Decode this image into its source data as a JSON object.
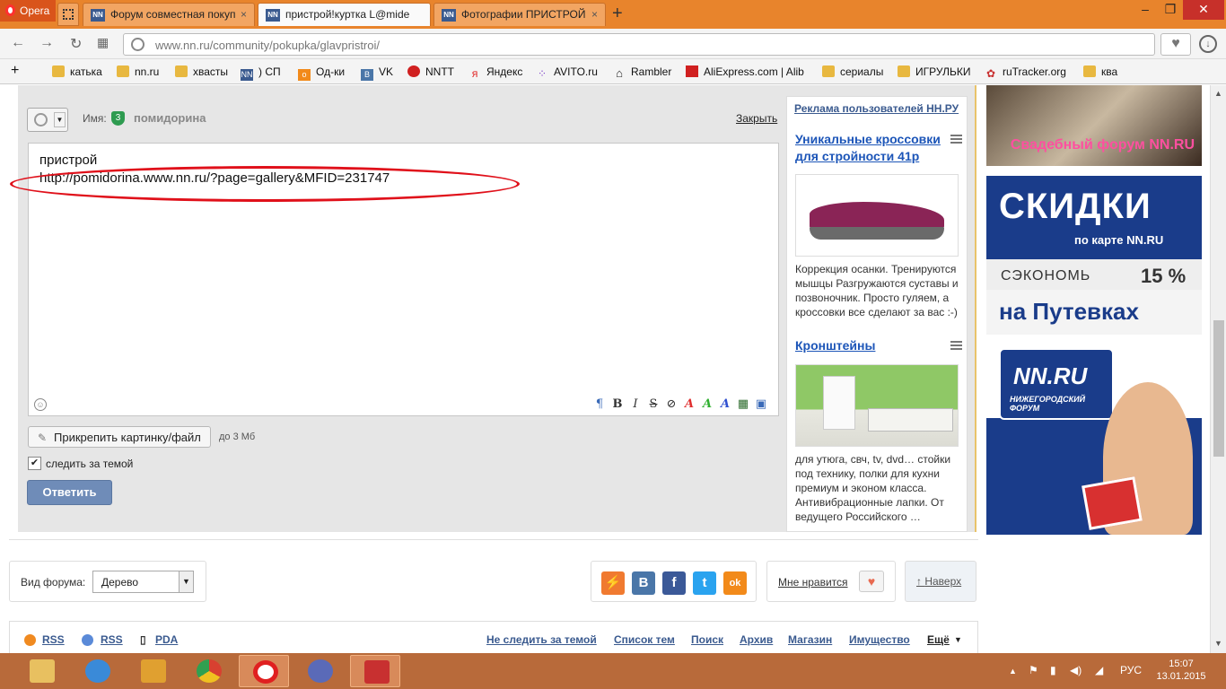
{
  "browser": {
    "menu_label": "Opera",
    "tabs": [
      {
        "label": "Форум совместная покуп",
        "active": false
      },
      {
        "label": "пристрой!куртка L@mide",
        "active": true
      },
      {
        "label": "Фотографии ПРИСТРОЙ",
        "active": false
      }
    ],
    "url": "www.nn.ru/community/pokupka/glavpristroi/",
    "bookmarks": [
      {
        "label": "катька",
        "icon": "folder-icon"
      },
      {
        "label": "nn.ru",
        "icon": "folder-icon"
      },
      {
        "label": "хвасты",
        "icon": "folder-icon"
      },
      {
        "label": ") СП",
        "icon": "nn-icon"
      },
      {
        "label": "Од-ки",
        "icon": "ok-icon"
      },
      {
        "label": "VK",
        "icon": "vk-icon"
      },
      {
        "label": "NNTT",
        "icon": "nntt-icon"
      },
      {
        "label": "Яндекс",
        "icon": "yandex-icon"
      },
      {
        "label": "AVITO.ru",
        "icon": "avito-icon"
      },
      {
        "label": "Rambler",
        "icon": "home-icon"
      },
      {
        "label": "AliExpress.com | Alib",
        "icon": "aliexpress-icon"
      },
      {
        "label": "сериалы",
        "icon": "folder-icon"
      },
      {
        "label": "ИГРУЛЬКИ",
        "icon": "folder-icon"
      },
      {
        "label": "ruTracker.org",
        "icon": "rutracker-icon"
      },
      {
        "label": "ква",
        "icon": "folder-icon"
      }
    ]
  },
  "reply": {
    "name_label": "Имя:",
    "user_level": "3",
    "username": "помидорина",
    "close_label": "Закрыть",
    "text_line1": "пристрой",
    "text_line2": "http://pomidorina.www.nn.ru/?page=gallery&MFID=231747",
    "toolbar": [
      "¶",
      "B",
      "I",
      "S",
      "⊘",
      "A",
      "A",
      "A",
      "▦",
      "▣"
    ],
    "attach_label": "Прикрепить картинку/файл",
    "size_note": "до 3 Мб",
    "follow_label": "следить за темой",
    "follow_checked": true,
    "submit_label": "Ответить"
  },
  "ads": {
    "header": "Реклама пользователей НН.РУ",
    "items": [
      {
        "title": "Уникальные кроссовки для стройности 41р",
        "text": "Коррекция осанки. Тренируются мышцы Разгружаются суставы и позвоночник. Просто гуляем, а кроссовки все сделают за вас :-)"
      },
      {
        "title": "Кронштейны",
        "text": "для утюга, свч, tv, dvd… стойки под технику, полки для кухни премиум и эконом класса. Антивибрационные лапки. От ведущего Российского …"
      }
    ]
  },
  "banners": {
    "wedding": "Свадебный форум NN.RU",
    "big": "СКИДКИ",
    "sub": "по карте NN.RU",
    "save": "СЭКОНОМЬ",
    "percent": "15 %",
    "on_trips": "на Путевках",
    "logo_text": "NN.RU",
    "logo_sub": "НИЖЕГОРОДСКИЙ ФОРУМ"
  },
  "bottom": {
    "view_label": "Вид форума:",
    "view_value": "Дерево",
    "like_label": "Мне нравится",
    "top_label": "Наверх",
    "share": [
      "⚡",
      "В",
      "f",
      "t",
      "ok"
    ]
  },
  "footer": {
    "links_left": [
      "RSS",
      "RSS",
      "PDA"
    ],
    "links_right": [
      "Не следить за темой",
      "Список тем",
      "Поиск",
      "Архив",
      "Магазин",
      "Имущество",
      "Ещё"
    ]
  },
  "taskbar": {
    "lang": "РУС",
    "time": "15:07",
    "date": "13.01.2015"
  }
}
